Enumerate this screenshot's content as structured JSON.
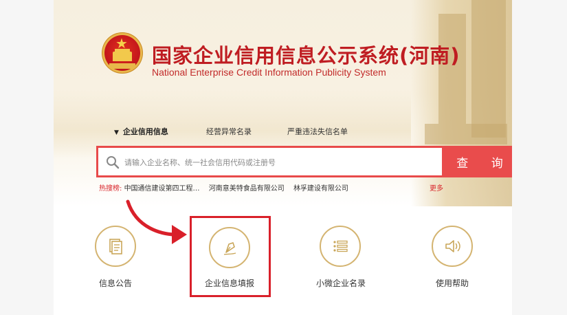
{
  "header": {
    "title_cn": "国家企业信用信息公示系统(河南)",
    "title_en": "National Enterprise Credit Information Publicity System"
  },
  "tabs": [
    {
      "label": "企业信用信息",
      "active": true
    },
    {
      "label": "经营异常名录",
      "active": false
    },
    {
      "label": "严重违法失信名单",
      "active": false
    }
  ],
  "search": {
    "placeholder": "请输入企业名称、统一社会信用代码或注册号",
    "button_label": "查 询"
  },
  "hot_search": {
    "label": "热搜榜:",
    "items": [
      "中国通信建设第四工程…",
      "河南意美特食品有限公司",
      "林孚建设有限公司"
    ],
    "more_label": "更多"
  },
  "features": [
    {
      "label": "信息公告",
      "icon": "document-icon"
    },
    {
      "label": "企业信息填报",
      "icon": "pen-icon",
      "highlighted": true
    },
    {
      "label": "小微企业名录",
      "icon": "list-icon"
    },
    {
      "label": "使用帮助",
      "icon": "speaker-icon"
    }
  ],
  "colors": {
    "brand_red": "#bf1d22",
    "search_red": "#e94c4c",
    "icon_gold": "#d4b471",
    "highlight": "#d9202a"
  }
}
